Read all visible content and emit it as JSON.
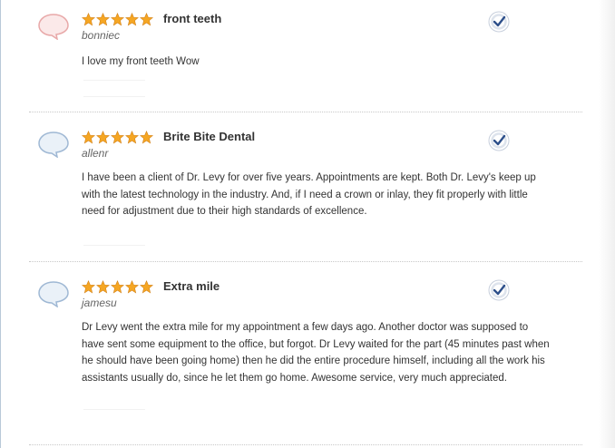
{
  "reviews": [
    {
      "title": "front teeth",
      "author": "bonniec",
      "body": "I love my front teeth Wow",
      "rating": 5,
      "avatar_color": "#e8a8a8",
      "avatar_fill": "#fbe9e9",
      "badge_icon": "certified-review-badge-icon"
    },
    {
      "title": "Brite Bite Dental",
      "author": "allenr",
      "body": "I have been a client of Dr. Levy for over five years. Appointments are kept. Both Dr. Levy's keep up with the latest technology in the industry. And, if I need a crown or inlay, they fit properly with little need for adjustment due to their high standards of excellence.",
      "rating": 5,
      "avatar_color": "#9fb8d4",
      "avatar_fill": "#eaf1f8",
      "badge_icon": "certified-review-badge-icon"
    },
    {
      "title": "Extra mile",
      "author": "jamesu",
      "body": "Dr Levy went the extra mile for my appointment a few days ago. Another doctor was supposed to have sent some equipment to the office, but forgot. Dr Levy waited for the part (45 minutes past when he should have been going home) then he did the entire procedure himself, including all the work his assistants usually do, since he let them go home. Awesome service, very much appreciated.",
      "rating": 5,
      "avatar_color": "#9fb8d4",
      "avatar_fill": "#eaf1f8",
      "badge_icon": "certified-review-badge-icon"
    }
  ],
  "colors": {
    "star": "#f5a623",
    "badge": "#2d4f8a"
  }
}
